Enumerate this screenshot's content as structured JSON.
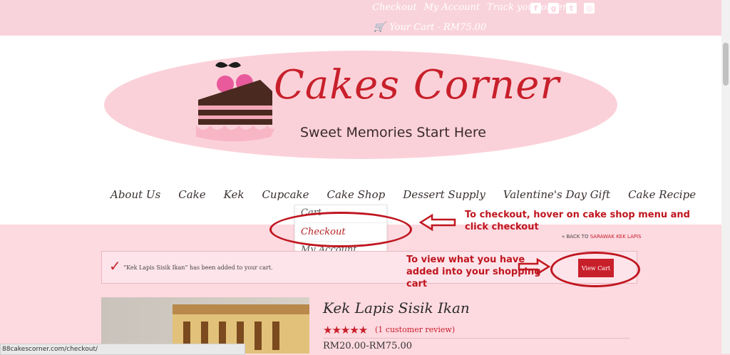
{
  "topbar": {
    "links": [
      "Checkout",
      "My Account",
      "Track your order"
    ],
    "social": [
      "facebook-icon",
      "google-plus-icon",
      "twitter-icon",
      "instagram-icon"
    ],
    "cart_label": "Your Cart - RM75.00"
  },
  "logo": {
    "title": "Cakes Corner",
    "tagline": "Sweet Memories Start Here"
  },
  "nav": [
    "About Us",
    "Cake",
    "Kek",
    "Cupcake",
    "Cake Shop",
    "Dessert Supply",
    "Valentine's Day Gift",
    "Cake Recipe"
  ],
  "dropdown": {
    "items": [
      "Cart",
      "Checkout",
      "My Account"
    ]
  },
  "annotations": {
    "checkout_hint": "To checkout, hover on cake shop menu and click checkout",
    "cart_hint": "To view what you have added into your shopping cart"
  },
  "breadcrumb": {
    "prefix": "« BACK TO",
    "link": "SARAWAK KEK LAPIS"
  },
  "notice": {
    "text": "“Kek Lapis Sisik Ikan” has been added to your cart.",
    "button": "View Cart"
  },
  "product": {
    "title": "Kek Lapis Sisik Ikan",
    "stars": "★★★★★",
    "review": "(1 customer review)",
    "price": "RM20.00-RM75.00"
  },
  "status_url": "88cakescorner.com/checkout/",
  "colors": {
    "accent": "#c8202b",
    "pink": "#fbd1d9"
  }
}
